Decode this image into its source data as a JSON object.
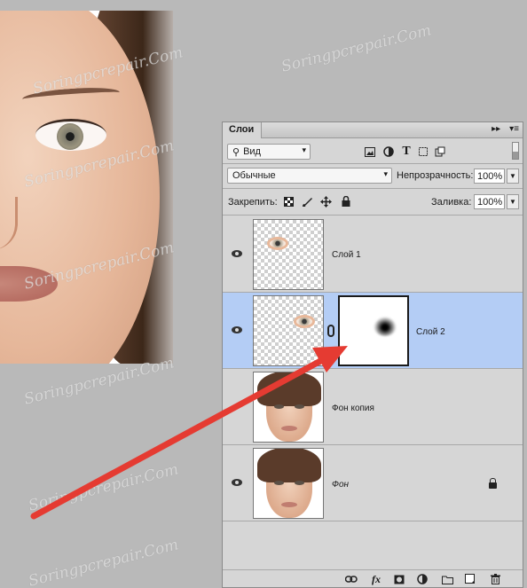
{
  "panel": {
    "tab_label": "Слои",
    "header_icons": [
      "collapse-icon",
      "panel-menu-icon"
    ]
  },
  "filter": {
    "kind_label": "Вид",
    "filter_icons": [
      "image-filter-icon",
      "adjustment-filter-icon",
      "type-filter-icon",
      "shape-filter-icon",
      "smart-object-filter-icon"
    ]
  },
  "blend": {
    "mode": "Обычные",
    "opacity_label": "Непрозрачность:",
    "opacity_value": "100%"
  },
  "lock": {
    "label": "Закрепить:",
    "fill_label": "Заливка:",
    "fill_value": "100%"
  },
  "layers": [
    {
      "name": "Слой 1",
      "visible": true,
      "selected": false,
      "has_mask": false,
      "locked": false
    },
    {
      "name": "Слой 2",
      "visible": true,
      "selected": true,
      "has_mask": true,
      "locked": false
    },
    {
      "name": "Фон копия",
      "visible": false,
      "selected": false,
      "has_mask": false,
      "locked": false
    },
    {
      "name": "Фон",
      "visible": true,
      "selected": false,
      "has_mask": false,
      "locked": true
    }
  ],
  "footer_icons": [
    "link-layers-icon",
    "fx-icon",
    "add-mask-icon",
    "adjustment-layer-icon",
    "new-group-icon",
    "new-layer-icon",
    "delete-layer-icon"
  ],
  "footer_fx_label": "fx",
  "watermark_text": "Soringpcrepair.Com",
  "colors": {
    "panel_bg": "#d6d6d6",
    "selected_layer": "#b4cdf5",
    "arrow": "#e53b32",
    "workspace": "#b9b9b9"
  }
}
